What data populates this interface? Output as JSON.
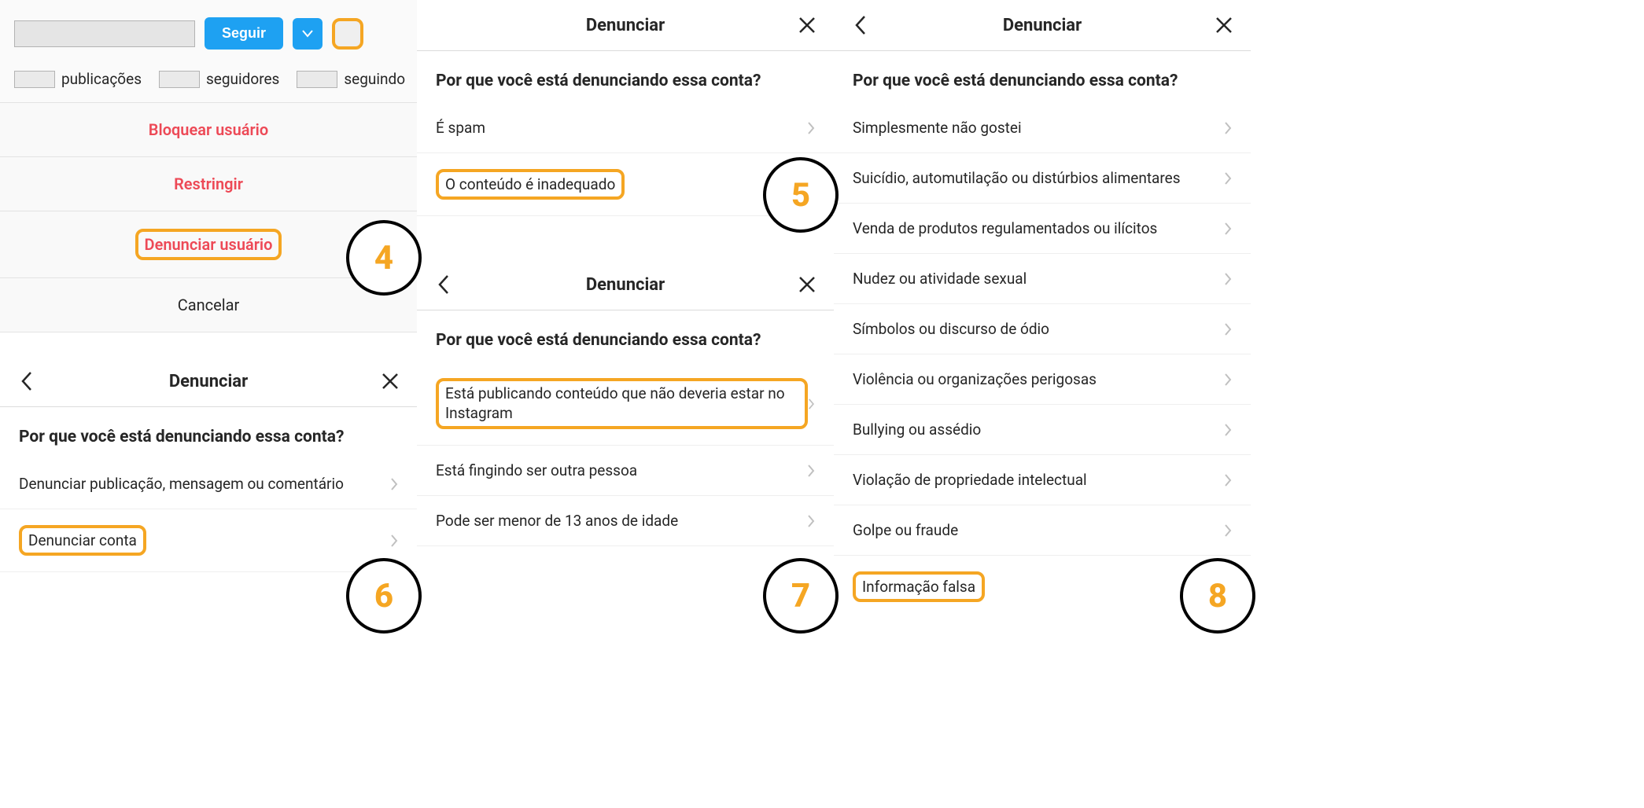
{
  "steps": {
    "s4": "4",
    "s5": "5",
    "s6": "6",
    "s7": "7",
    "s8": "8"
  },
  "profile": {
    "follow": "Seguir",
    "posts_label": "publicações",
    "followers_label": "seguidores",
    "following_label": "seguindo"
  },
  "action_sheet": {
    "block": "Bloquear usuário",
    "restrict": "Restringir",
    "report": "Denunciar usuário",
    "cancel": "Cancelar"
  },
  "report": {
    "title": "Denunciar",
    "question": "Por que você está denunciando essa conta?"
  },
  "panel5": {
    "opt1": "É spam",
    "opt2": "O conteúdo é inadequado"
  },
  "panel6": {
    "opt1": "Denunciar publicação, mensagem ou comentário",
    "opt2": "Denunciar conta"
  },
  "panel7": {
    "opt1": "Está publicando conteúdo que não deveria estar no Instagram",
    "opt2": "Está fingindo ser outra pessoa",
    "opt3": "Pode ser menor de 13 anos de idade"
  },
  "panel8": {
    "opt1": "Simplesmente não gostei",
    "opt2": "Suicídio, automutilação ou distúrbios alimentares",
    "opt3": "Venda de produtos regulamentados ou ilícitos",
    "opt4": "Nudez ou atividade sexual",
    "opt5": "Símbolos ou discurso de ódio",
    "opt6": "Violência ou organizações perigosas",
    "opt7": "Bullying ou assédio",
    "opt8": "Violação de propriedade intelectual",
    "opt9": "Golpe ou fraude",
    "opt10": "Informação falsa"
  }
}
